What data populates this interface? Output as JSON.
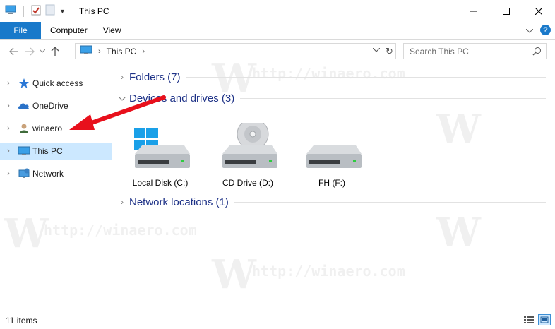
{
  "window": {
    "title": "This PC",
    "controls": [
      "minimize-icon",
      "maximize-icon",
      "close-icon"
    ]
  },
  "ribbon": {
    "tabs": [
      {
        "label": "File",
        "active": true
      },
      {
        "label": "Computer"
      },
      {
        "label": "View"
      }
    ],
    "help_label": "?"
  },
  "address": {
    "path": [
      "This PC"
    ],
    "search_placeholder": "Search This PC"
  },
  "nav_pane": {
    "items": [
      {
        "label": "Quick access",
        "icon": "star-icon"
      },
      {
        "label": "OneDrive",
        "icon": "cloud-icon"
      },
      {
        "label": "winaero",
        "icon": "user-icon"
      },
      {
        "label": "This PC",
        "icon": "computer-icon",
        "selected": true
      },
      {
        "label": "Network",
        "icon": "network-icon"
      }
    ]
  },
  "content": {
    "groups": [
      {
        "label": "Folders (7)",
        "expanded": false
      },
      {
        "label": "Devices and drives (3)",
        "expanded": true
      },
      {
        "label": "Network locations (1)",
        "expanded": false
      }
    ],
    "drives": [
      {
        "label": "Local Disk (C:)",
        "icon": "system-drive-icon"
      },
      {
        "label": "CD Drive (D:)",
        "icon": "cd-drive-icon"
      },
      {
        "label": "FH (F:)",
        "icon": "hard-drive-icon"
      }
    ]
  },
  "status": {
    "item_count": "11 items"
  },
  "watermark": {
    "text": "http://winaero.com",
    "logo": "W"
  },
  "colors": {
    "accent": "#1979ca",
    "selection": "#cce8ff",
    "group_header": "#1e3287",
    "annotation_arrow": "#e8101c"
  }
}
